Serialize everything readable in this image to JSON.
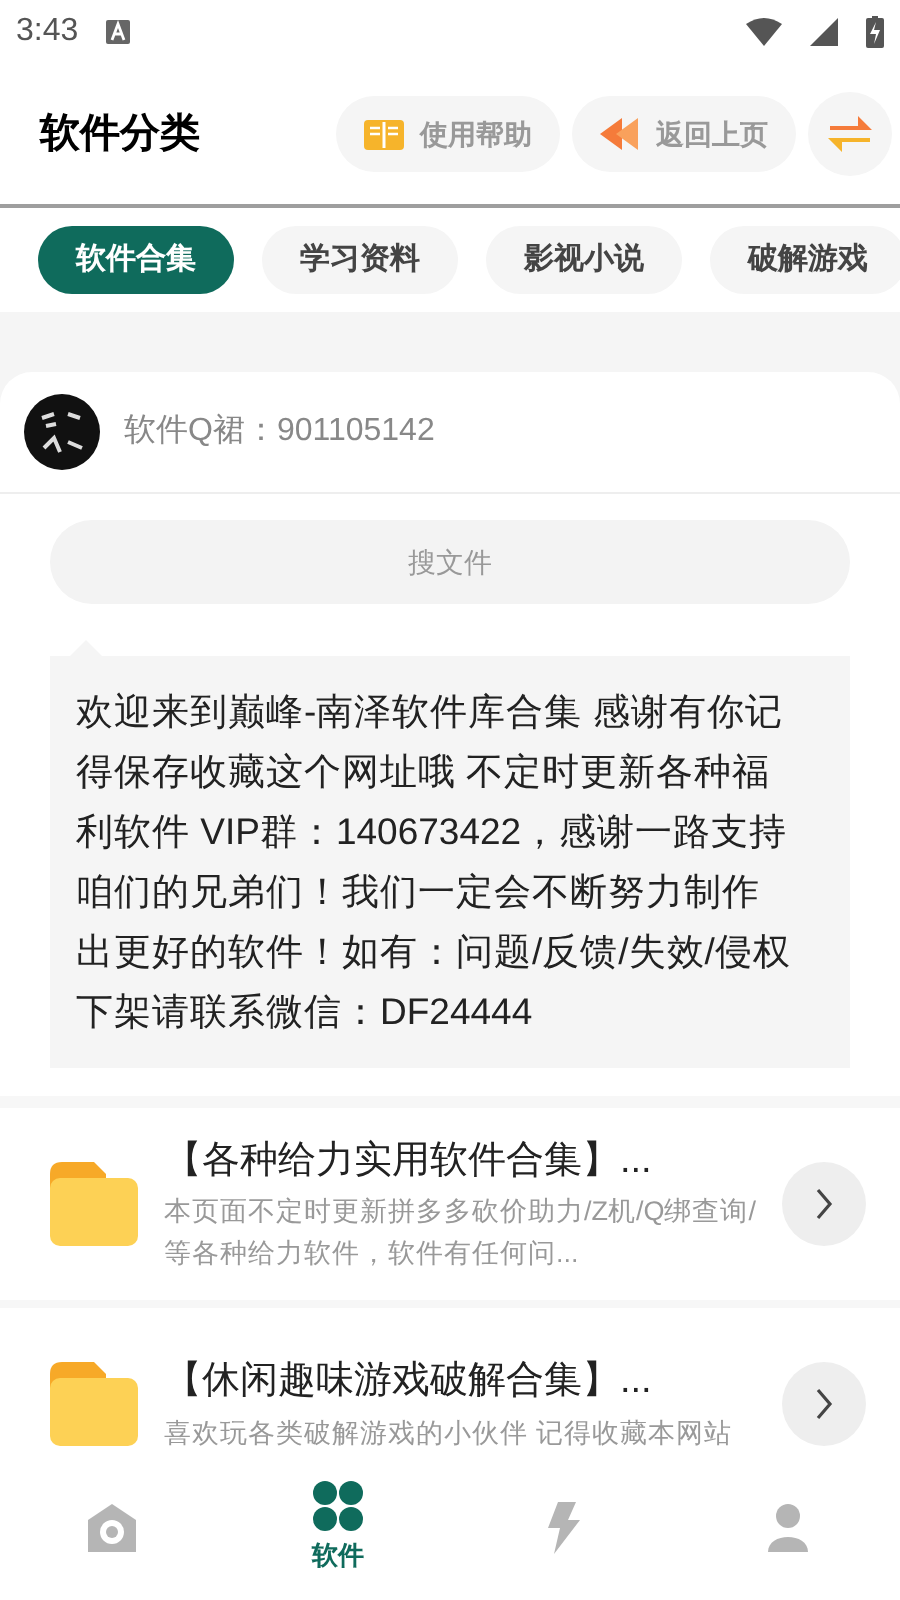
{
  "status_bar": {
    "time": "3:43"
  },
  "header": {
    "title": "软件分类",
    "buttons": [
      {
        "label": "使用帮助",
        "kind": "help"
      },
      {
        "label": "返回上页",
        "kind": "back"
      }
    ]
  },
  "tabs": [
    {
      "label": "软件合集",
      "selected": true
    },
    {
      "label": "学习资料",
      "selected": false
    },
    {
      "label": "影视小说",
      "selected": false
    },
    {
      "label": "破解游戏",
      "selected": false
    }
  ],
  "group": {
    "text": "软件Q裙：901105142"
  },
  "search": {
    "placeholder": "搜文件"
  },
  "notice": "欢迎来到巅峰-南泽软件库合集 感谢有你记得保存收藏这个网址哦 不定时更新各种福利软件 VIP群：140673422，感谢一路支持咱们的兄弟们！我们一定会不断努力制作出更好的软件！如有：问题/反馈/失效/侵权下架请联系微信：DF24444",
  "files": [
    {
      "title": "【各种给力实用软件合集】...",
      "description": "本页面不定时更新拼多多砍价助力/Z机/Q绑查询/等各种给力软件，软件有任何问..."
    },
    {
      "title": "【休闲趣味游戏破解合集】...",
      "description": "喜欢玩各类破解游戏的小伙伴 记得收藏本网站"
    }
  ],
  "bottom_nav": [
    {
      "kind": "home",
      "selected": false
    },
    {
      "kind": "apps",
      "label": "软件",
      "selected": true
    },
    {
      "kind": "flash",
      "selected": false
    },
    {
      "kind": "profile",
      "selected": false
    }
  ]
}
